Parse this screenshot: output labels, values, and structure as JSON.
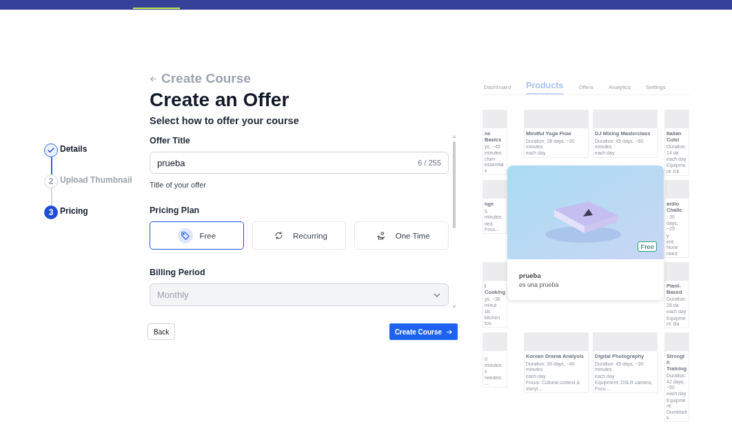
{
  "back_link": "Create Course",
  "title": "Create an Offer",
  "subtitle": "Select how to offer your course",
  "steps": [
    {
      "label": "Details",
      "completed": true,
      "current": false
    },
    {
      "number": "2",
      "label": "Upload Thumbnail",
      "completed": false,
      "current": false
    },
    {
      "number": "3",
      "label": "Pricing",
      "completed": false,
      "current": true
    }
  ],
  "offer_title": {
    "label": "Offer Title",
    "value": "prueba",
    "counter": "6 / 255",
    "helper": "Title of your offer"
  },
  "pricing_plan": {
    "label": "Pricing Plan",
    "options": [
      {
        "label": "Free",
        "kind": "tag",
        "selected": true
      },
      {
        "label": "Recurring",
        "kind": "cycle",
        "selected": false
      },
      {
        "label": "One Time",
        "kind": "hand",
        "selected": false
      }
    ]
  },
  "billing_period": {
    "label": "Billing Period",
    "value": "Monthly",
    "disabled": true
  },
  "buttons": {
    "back": "Back",
    "create": "Create Course"
  },
  "preview": {
    "tabs": [
      {
        "label": "Dashboard",
        "selected": false
      },
      {
        "label": "Products",
        "selected": true
      },
      {
        "label": "Offers",
        "selected": false
      },
      {
        "label": "Analytics",
        "selected": false
      },
      {
        "label": "Settings",
        "selected": false
      }
    ],
    "rows": [
      {
        "cards": [
          {
            "title": "ne Basics",
            "lines": [
              "ys, ~45 minutes",
              "chen essentials"
            ]
          },
          {
            "title": "Mindful Yoga Flow",
            "lines": [
              "Duration: 28 days, ~30 minutes",
              "each day"
            ]
          },
          {
            "title": "DJ Mixing Masterclass",
            "lines": [
              "Duration: 45 days, ~60 minutes",
              "each day"
            ]
          },
          {
            "title": "Italian Cuisi",
            "lines": [
              "Duration: 14 da",
              "each day",
              "Equipment: Kit"
            ]
          }
        ]
      },
      {
        "cards": [
          {
            "title": "nge",
            "lines": [
              "5 minutes",
              "ded. Focu..."
            ]
          },
          {
            "title": "ardio Challe",
            "lines": [
              ": 30 days, ~25",
              "y",
              "ent: None need"
            ]
          }
        ]
      },
      {
        "cards": [
          {
            "title": "l Cooking",
            "lines": [
              "ys, ~35 minut",
              "sic kitchen too"
            ]
          },
          {
            "title": "Plant-Based",
            "lines": [
              "Duration: 28 da",
              "each day",
              "Equipment: Ba"
            ]
          }
        ]
      },
      {
        "cards": [
          {
            "lines": [
              "0 minutes",
              "s needed. ..."
            ]
          },
          {
            "title": "Korean Drama Analysis",
            "lines": [
              "Duration: 30 days, ~40 minutes",
              "each day",
              "Focus: Cultural context & storyt..."
            ]
          },
          {
            "title": "Digital Photography",
            "lines": [
              "Duration: 45 days, ~30 minutes",
              "each day",
              "Equipment: DSLR camera, Focu..."
            ]
          },
          {
            "title": "Strength Training",
            "lines": [
              "Duration: 42 days, ~50",
              "each day",
              "Equipment: Dumbbells"
            ]
          }
        ]
      }
    ],
    "card": {
      "kind": "picture",
      "badge": "Free",
      "name": "prueba",
      "description": "es una prueba"
    }
  }
}
